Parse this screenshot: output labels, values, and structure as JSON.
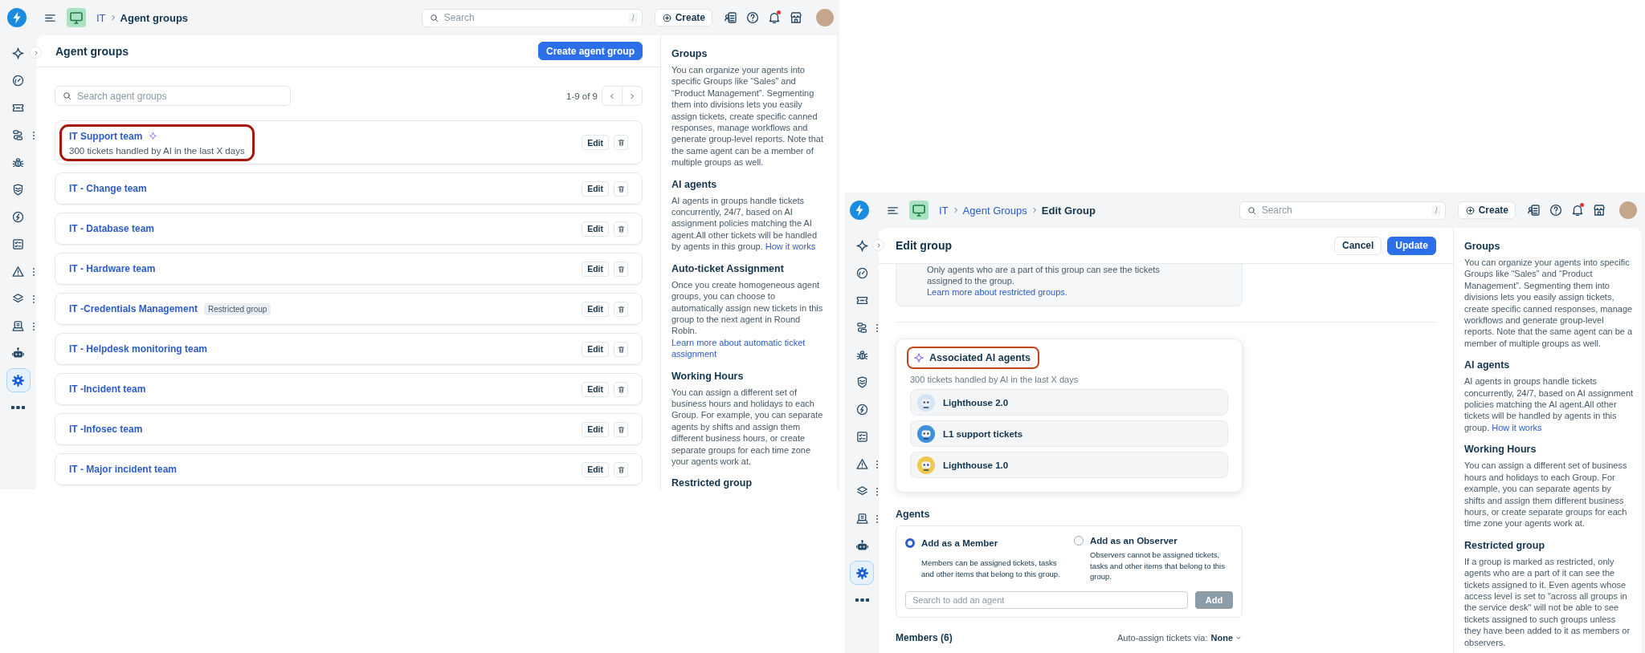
{
  "screens": [
    {
      "kind": "group_list",
      "topbar": {
        "breadcrumb": [
          {
            "text": "IT",
            "current": false
          },
          {
            "text": "Agent groups",
            "current": true
          }
        ],
        "search": {
          "placeholder": "Search",
          "shortcut": "/"
        },
        "create_label": "Create",
        "notification_dot": true
      },
      "sidebar": [
        {
          "selected": false,
          "menu": false
        },
        {
          "selected": false,
          "menu": false
        },
        {
          "selected": false,
          "menu": false
        },
        {
          "selected": false,
          "menu": true
        },
        {
          "selected": false,
          "menu": false
        },
        {
          "selected": false,
          "menu": false
        },
        {
          "selected": false,
          "menu": false
        },
        {
          "selected": false,
          "menu": false
        },
        {
          "selected": false,
          "menu": true
        },
        {
          "selected": false,
          "menu": true
        },
        {
          "selected": false,
          "menu": true
        },
        {
          "selected": false,
          "menu": false
        },
        {
          "selected": true,
          "menu": false
        },
        {
          "selected": false,
          "menu": false
        }
      ],
      "header": {
        "title": "Agent groups",
        "actions": [
          {
            "label": "Create agent group",
            "kind": "primary"
          }
        ]
      },
      "search": {
        "placeholder": "Search agent groups"
      },
      "pagination": "1-9 of 9",
      "groups": [
        {
          "name": "IT Support team",
          "ai": true,
          "subtitle": "300 tickets handled by AI in the last X days",
          "highlighted": true,
          "edit": "Edit"
        },
        {
          "name": "IT - Change team",
          "ai": false,
          "highlighted": false,
          "edit": "Edit"
        },
        {
          "name": "IT - Database team",
          "ai": false,
          "highlighted": false,
          "edit": "Edit"
        },
        {
          "name": "IT - Hardware team",
          "ai": false,
          "highlighted": false,
          "edit": "Edit"
        },
        {
          "name": "IT -Credentials Management",
          "ai": false,
          "tag": "Restricted group",
          "highlighted": false,
          "edit": "Edit"
        },
        {
          "name": "IT - Helpdesk monitoring team",
          "ai": false,
          "highlighted": false,
          "edit": "Edit"
        },
        {
          "name": "IT -Incident team",
          "ai": false,
          "highlighted": false,
          "edit": "Edit"
        },
        {
          "name": "IT -Infosec team",
          "ai": false,
          "highlighted": false,
          "edit": "Edit"
        },
        {
          "name": "IT - Major incident team",
          "ai": false,
          "highlighted": false,
          "edit": "Edit"
        }
      ],
      "help": [
        {
          "title": "Groups",
          "body": "You can organize your agents into specific Groups like “Sales” and “Product Management”. Segmenting them into divisions lets you easily assign tickets, create specific canned responses, manage workflows and generate group-level reports. Note that the same agent can be a member of multiple groups as well."
        },
        {
          "title": "AI agents",
          "body": "AI agents in groups handle tickets concurrently, 24/7, based on AI assignment policies matching the AI agent.All other tickets will be handled by agents in this group.",
          "link": "How it works"
        },
        {
          "title": "Auto-ticket Assignment",
          "body": "Once you create homogeneous agent groups, you can choose to automatically assign new tickets in this group to the next agent in Round Robin.",
          "link": "Learn more about automatic ticket assignment"
        },
        {
          "title": "Working Hours",
          "body": "You can assign a different set of business hours and holidays to each Group. For example, you can separate agents by shifts and assign them different business hours, or create separate groups for each time zone your agents work at."
        },
        {
          "title": "Restricted group"
        }
      ]
    },
    {
      "kind": "edit_group",
      "topbar": {
        "breadcrumb": [
          {
            "text": "IT",
            "current": false
          },
          {
            "text": "Agent Groups",
            "current": false
          },
          {
            "text": "Edit Group",
            "current": true
          }
        ],
        "search": {
          "placeholder": "Search",
          "shortcut": "/"
        },
        "create_label": "Create",
        "notification_dot": true
      },
      "sidebar": [
        {
          "selected": false,
          "menu": false
        },
        {
          "selected": false,
          "menu": false
        },
        {
          "selected": false,
          "menu": false
        },
        {
          "selected": false,
          "menu": true
        },
        {
          "selected": false,
          "menu": false
        },
        {
          "selected": false,
          "menu": false
        },
        {
          "selected": false,
          "menu": false
        },
        {
          "selected": false,
          "menu": false
        },
        {
          "selected": false,
          "menu": true
        },
        {
          "selected": false,
          "menu": true
        },
        {
          "selected": false,
          "menu": true
        },
        {
          "selected": false,
          "menu": false
        },
        {
          "selected": true,
          "menu": false
        },
        {
          "selected": false,
          "menu": false
        }
      ],
      "header": {
        "title": "Edit group",
        "actions": [
          {
            "label": "Cancel",
            "kind": "secondary"
          },
          {
            "label": "Update",
            "kind": "primary"
          }
        ]
      },
      "restricted_info": {
        "text": "Only agents who are a part of this group can see the tickets assigned to the group.",
        "link": "Learn more about restricted groups."
      },
      "ai_card": {
        "title": "Associated AI agents",
        "highlighted": true,
        "subtitle": "300 tickets handled by AI in the last X days",
        "agents": [
          {
            "name": "Lighthouse 2.0",
            "color": "#d3e5f4"
          },
          {
            "name": "L1 support tickets",
            "color": "#3f8fdb"
          },
          {
            "name": "Lighthouse 1.0",
            "color": "#f1c74e"
          }
        ]
      },
      "agents": {
        "title": "Agents",
        "roles": [
          {
            "label": "Add as a Member",
            "description": "Members can be assigned tickets, tasks and other items that belong to this group.",
            "selected": true
          },
          {
            "label": "Add as an Observer",
            "description": "Observers cannot be assigned tickets, tasks and other items that belong to this group.",
            "selected": false
          }
        ],
        "search": {
          "placeholder": "Search to add an agent"
        },
        "add_button": {
          "label": "Add",
          "disabled": true
        }
      },
      "members": {
        "title": "Members (6)",
        "auto_assign_label": "Auto-assign tickets via:",
        "auto_assign_value": "None"
      },
      "help": [
        {
          "title": "Groups",
          "body": "You can organize your agents into specific Groups like “Sales” and “Product Management”. Segmenting them into divisions lets you easily assign tickets, create specific canned responses, manage workflows and generate group-level reports. Note that the same agent can be a member of multiple groups as well."
        },
        {
          "title": "AI agents",
          "body": "AI agents in groups handle tickets concurrently, 24/7, based on AI assignment policies matching the AI agent.All other tickets will be handled by agents in this group.",
          "link": "How it works"
        },
        {
          "title": "Working Hours",
          "body": "You can assign a different set of business hours and holidays to each Group. For example, you can separate agents by shifts and assign them different business hours, or create separate groups for each time zone your agents work at."
        },
        {
          "title": "Restricted group",
          "body": "If a group is marked as restricted, only agents who are a part of it can see the tickets assigned to it. Even agents whose access level is set to \"across all groups in the service desk\" will not be able to see tickets assigned to such groups unless they have been added to it as members or observers."
        }
      ]
    }
  ]
}
